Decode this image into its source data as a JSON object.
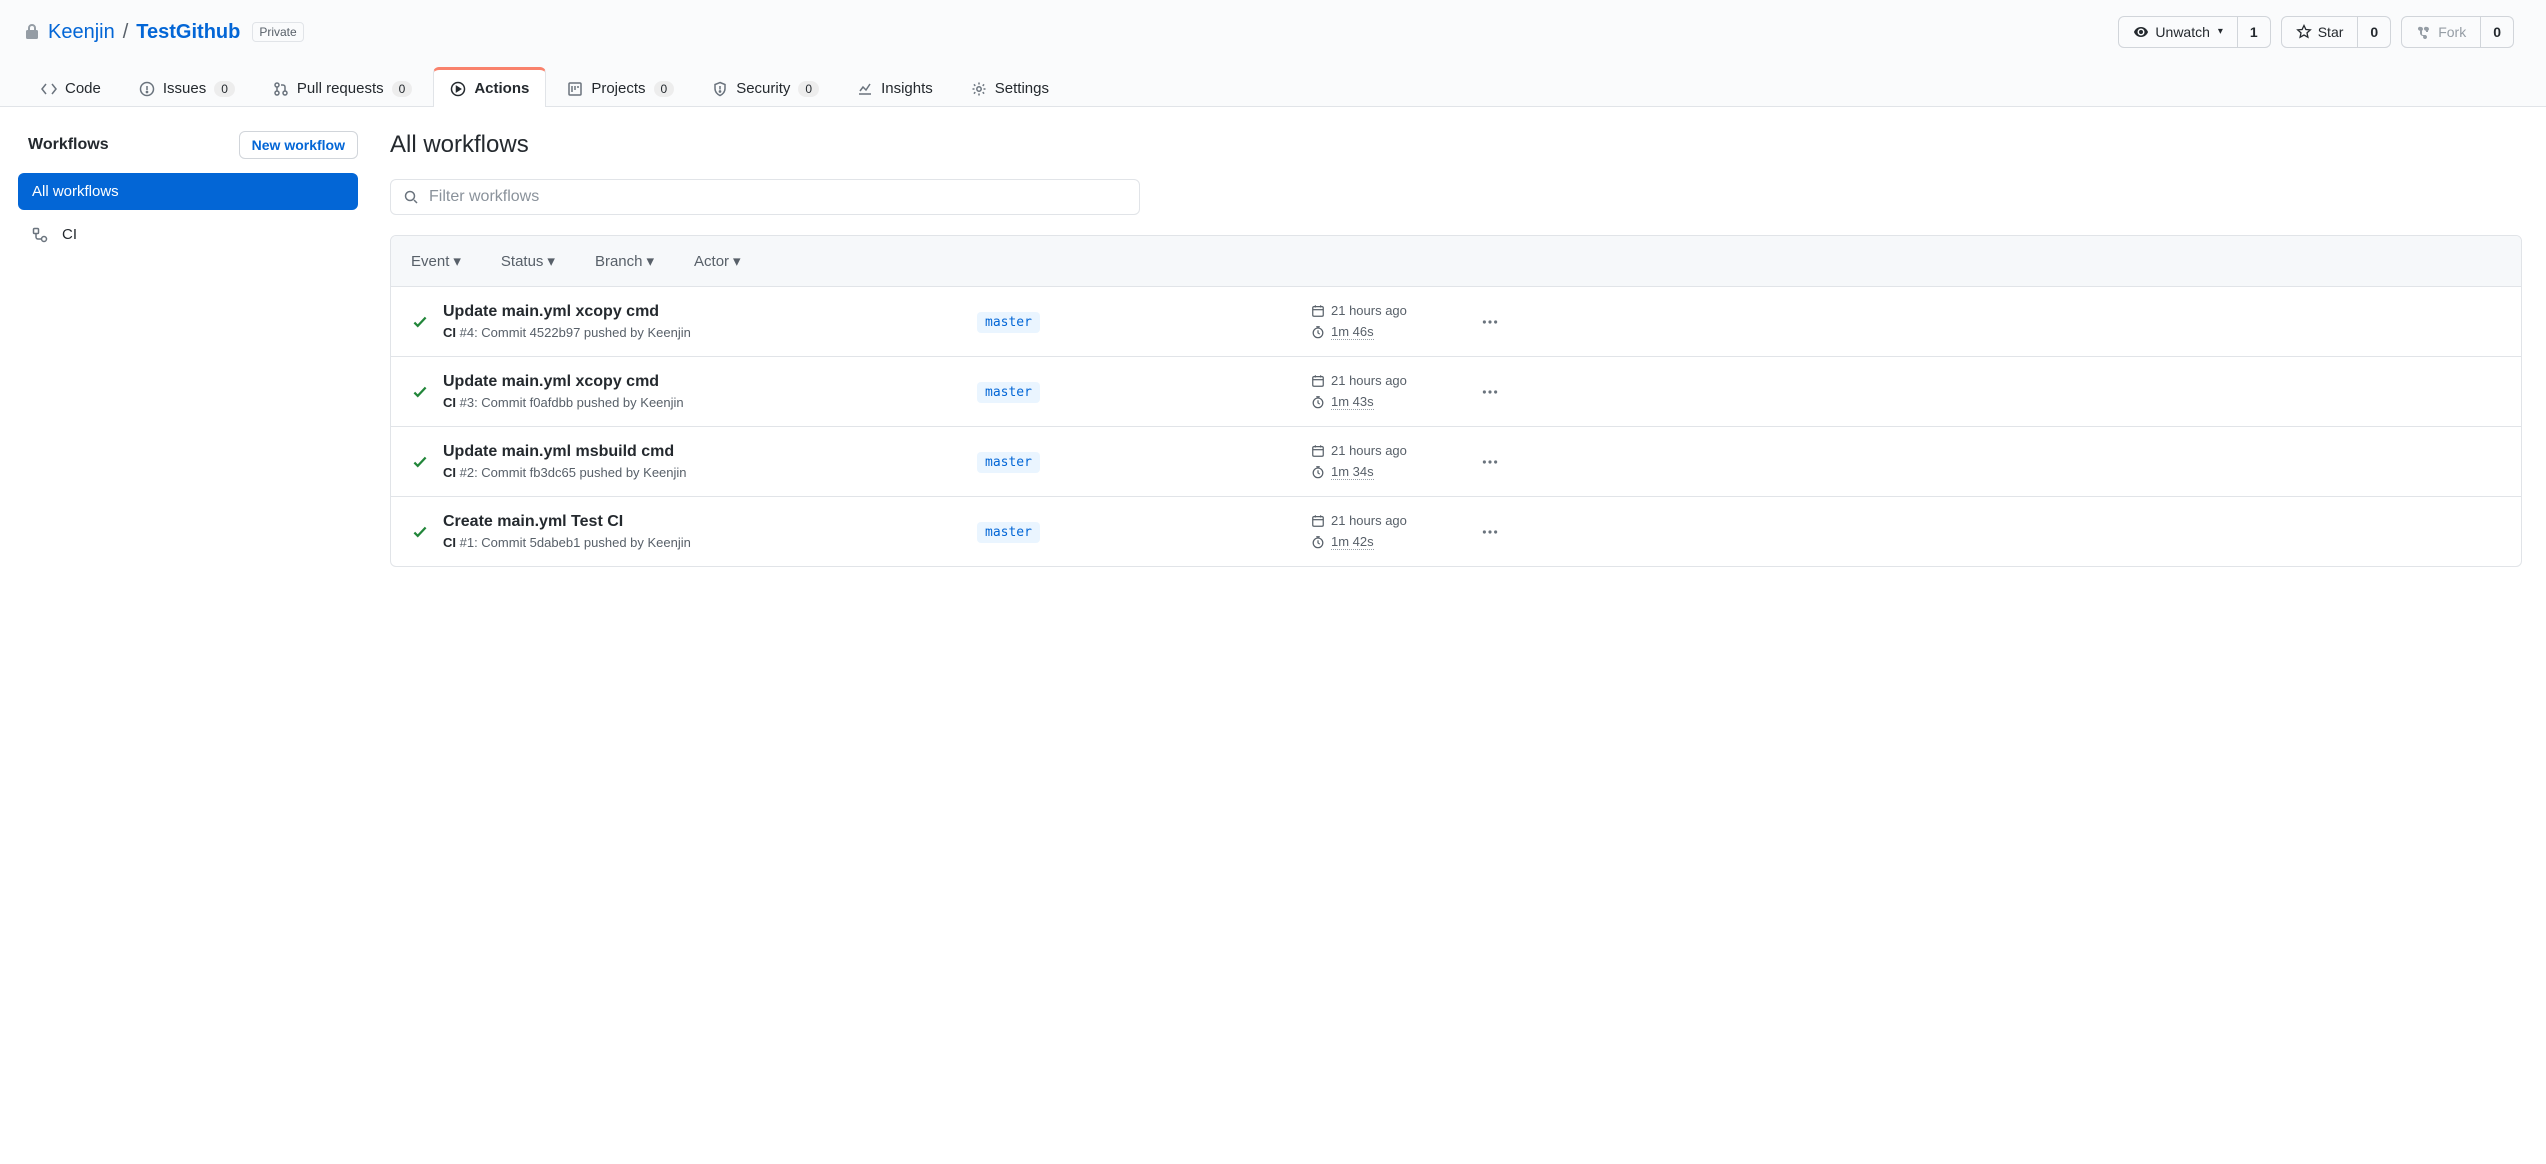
{
  "repo": {
    "owner": "Keenjin",
    "name": "TestGithub",
    "visibility": "Private"
  },
  "repo_buttons": {
    "watch_label": "Unwatch",
    "watch_count": "1",
    "star_label": "Star",
    "star_count": "0",
    "fork_label": "Fork",
    "fork_count": "0"
  },
  "tabs": {
    "code": "Code",
    "issues": "Issues",
    "issues_count": "0",
    "pulls": "Pull requests",
    "pulls_count": "0",
    "actions": "Actions",
    "projects": "Projects",
    "projects_count": "0",
    "security": "Security",
    "security_count": "0",
    "insights": "Insights",
    "settings": "Settings"
  },
  "sidebar": {
    "heading": "Workflows",
    "new_btn": "New workflow",
    "all_label": "All workflows",
    "items": [
      {
        "label": "CI"
      }
    ]
  },
  "content": {
    "heading": "All workflows",
    "filter_placeholder": "Filter workflows"
  },
  "run_filters": {
    "event": "Event",
    "status": "Status",
    "branch": "Branch",
    "actor": "Actor"
  },
  "runs": [
    {
      "title": "Update main.yml xcopy cmd",
      "workflow": "CI",
      "run_number": "#4",
      "commit": "4522b97",
      "pusher": "Keenjin",
      "branch": "master",
      "time": "21 hours ago",
      "duration": "1m 46s"
    },
    {
      "title": "Update main.yml xcopy cmd",
      "workflow": "CI",
      "run_number": "#3",
      "commit": "f0afdbb",
      "pusher": "Keenjin",
      "branch": "master",
      "time": "21 hours ago",
      "duration": "1m 43s"
    },
    {
      "title": "Update main.yml msbuild cmd",
      "workflow": "CI",
      "run_number": "#2",
      "commit": "fb3dc65",
      "pusher": "Keenjin",
      "branch": "master",
      "time": "21 hours ago",
      "duration": "1m 34s"
    },
    {
      "title": "Create main.yml Test CI",
      "workflow": "CI",
      "run_number": "#1",
      "commit": "5dabeb1",
      "pusher": "Keenjin",
      "branch": "master",
      "time": "21 hours ago",
      "duration": "1m 42s"
    }
  ],
  "strings": {
    "commit_word": "Commit",
    "pushed_by": "pushed by"
  }
}
